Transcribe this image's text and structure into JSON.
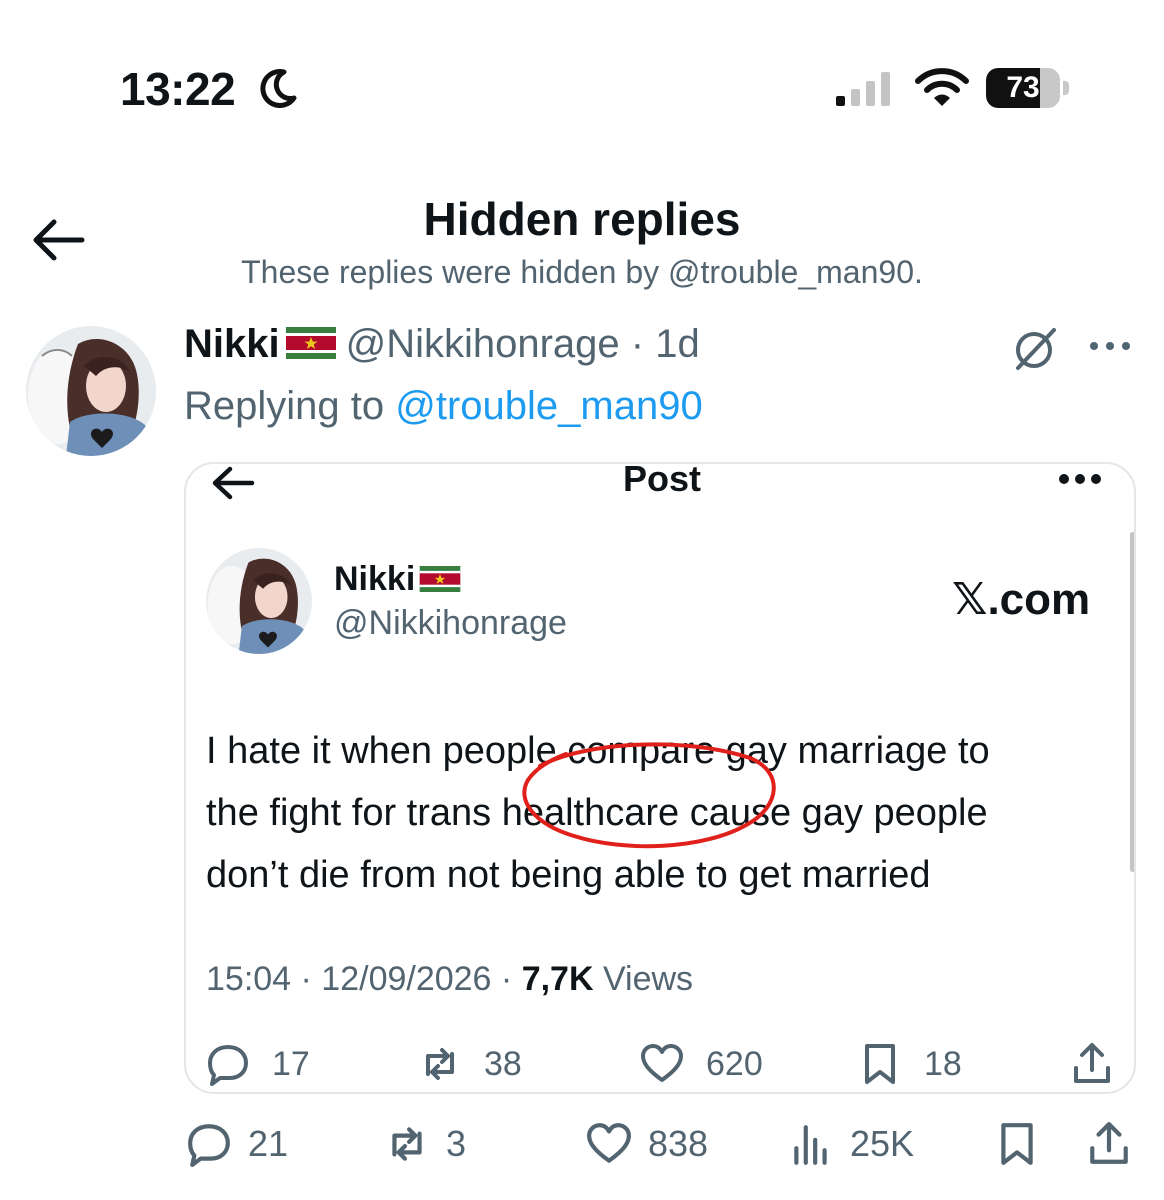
{
  "status_bar": {
    "time": "13:22",
    "battery_level": "73",
    "moon_icon": "moon-icon",
    "signal_icon": "cellular-signal-icon",
    "wifi_icon": "wifi-icon"
  },
  "header": {
    "title": "Hidden replies",
    "subtitle": "These replies were hidden by @trouble_man90.",
    "back_icon": "back-arrow-icon"
  },
  "reply": {
    "name": "Nikki",
    "flag_icon": "suriname-flag-icon",
    "handle": "@Nikkihonrage",
    "separator": "·",
    "time": "1d",
    "replying_label": "Replying to",
    "replying_handle": "@trouble_man90",
    "grok_icon": "grok-icon",
    "more_icon": "more-dots-icon",
    "actions": {
      "replies": "21",
      "reposts": "3",
      "likes": "838",
      "views": "25K"
    }
  },
  "embedded_post": {
    "title": "Post",
    "name": "Nikki",
    "handle": "@Nikkihonrage",
    "brand": "𝕏.com",
    "text_lines": [
      "I hate it when people compare gay marriage to",
      "the fight for trans healthcare cause gay people",
      "don’t die from not being able to get married"
    ],
    "meta_time": "15:04 · 12/09/2026 · ",
    "meta_views_count": "7,7K",
    "meta_views_label": " Views",
    "actions": {
      "replies": "17",
      "reposts": "38",
      "likes": "620",
      "bookmarks": "18"
    }
  },
  "colors": {
    "link": "#1d9bf0",
    "secondary": "#536471",
    "annotation": "#e0201a"
  }
}
